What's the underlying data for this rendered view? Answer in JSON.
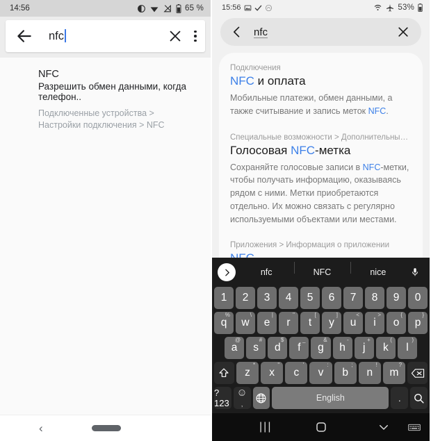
{
  "left_phone": {
    "status_bar": {
      "time": "14:56",
      "battery_percent": "65 %",
      "icons": [
        "do-not-disturb-icon",
        "wifi-icon",
        "signal-off-icon",
        "battery-icon"
      ]
    },
    "search_bar": {
      "query": "nfc",
      "back_icon": "back-arrow-icon",
      "clear_icon": "close-icon",
      "menu_icon": "overflow-menu-icon"
    },
    "result": {
      "title": "NFC",
      "subtitle": "Разрешить обмен данными, когда телефон..",
      "path": "Подключенные устройства > Настройки подключения > NFC"
    },
    "nav_bar": {
      "back_icon": "back-chevron-icon",
      "home_icon": "home-pill-icon"
    }
  },
  "right_phone": {
    "status_bar": {
      "time": "15:56",
      "battery_percent": "53%",
      "left_icons": [
        "gallery-icon",
        "check-icon",
        "cloud-icon"
      ],
      "right_icons": [
        "wifi-icon",
        "airplane-mode-icon",
        "battery-icon"
      ]
    },
    "search_bar": {
      "query": "nfc",
      "back_icon": "back-chevron-icon",
      "clear_icon": "close-icon"
    },
    "results": [
      {
        "crumb": "Подключения",
        "title_pre": "NFC",
        "title_post": " и оплата",
        "desc_pre": "Мобильные платежи, обмен данными, а также считывание и запись меток ",
        "desc_hl": "NFC",
        "desc_post": "."
      },
      {
        "crumb": "Специальные возможности > Дополнительные пар...",
        "title_pre2": "Голосовая ",
        "title_hl": "NFC",
        "title_post2": "-метка",
        "desc_pre": "Сохраняйте голосовые записи в ",
        "desc_hl": "NFC",
        "desc_post": "-метки, чтобы получать информацию, оказываясь рядом с ними. Метки приобретаются отдельно. Их можно связать с регулярно используемыми объектами или местами."
      },
      {
        "crumb": "Приложения > Информация о приложении",
        "only_title": "NFC"
      }
    ],
    "keyboard": {
      "suggestions": [
        "nfc",
        "NFC",
        "nice"
      ],
      "expand_icon": "chevron-right-icon",
      "mic_icon": "microphone-icon",
      "row_numbers": [
        "1",
        "2",
        "3",
        "4",
        "5",
        "6",
        "7",
        "8",
        "9",
        "0"
      ],
      "row1": [
        {
          "k": "q",
          "s": "%"
        },
        {
          "k": "w",
          "s": "\\"
        },
        {
          "k": "e",
          "s": "|"
        },
        {
          "k": "r",
          "s": "\""
        },
        {
          "k": "t",
          "s": "["
        },
        {
          "k": "y",
          "s": "]"
        },
        {
          "k": "u",
          "s": "<"
        },
        {
          "k": "i",
          "s": ">"
        },
        {
          "k": "o",
          "s": "{"
        },
        {
          "k": "p",
          "s": "}"
        }
      ],
      "row2": [
        {
          "k": "a",
          "s": "@"
        },
        {
          "k": "s",
          "s": "#"
        },
        {
          "k": "d",
          "s": "$"
        },
        {
          "k": "f",
          "s": "_"
        },
        {
          "k": "g",
          "s": "&"
        },
        {
          "k": "h",
          "s": "-"
        },
        {
          "k": "j",
          "s": "+"
        },
        {
          "k": "k",
          "s": "("
        },
        {
          "k": "l",
          "s": ")"
        }
      ],
      "row3": [
        {
          "k": "z",
          "s": "*"
        },
        {
          "k": "x",
          "s": "\""
        },
        {
          "k": "c",
          "s": "'"
        },
        {
          "k": "v",
          "s": ":"
        },
        {
          "k": "b",
          "s": ";"
        },
        {
          "k": "n",
          "s": "!"
        },
        {
          "k": "m",
          "s": "?"
        }
      ],
      "shift_icon": "shift-icon",
      "backspace_icon": "backspace-icon",
      "symbols_label": "?123",
      "comma_label": ",",
      "emoji_icon": "emoji-icon",
      "globe_icon": "language-globe-icon",
      "space_label": "English",
      "period_label": ".",
      "search_icon": "search-icon"
    },
    "nav_bar": {
      "recents_icon": "recents-icon",
      "home_icon": "home-icon",
      "down_icon": "hide-keyboard-icon",
      "keyboard_icon": "keyboard-switch-icon"
    }
  },
  "colors": {
    "accent_blue": "#3d80e8",
    "key_gray": "#6e6e6e",
    "keyboard_bg": "#1c1c1c"
  }
}
